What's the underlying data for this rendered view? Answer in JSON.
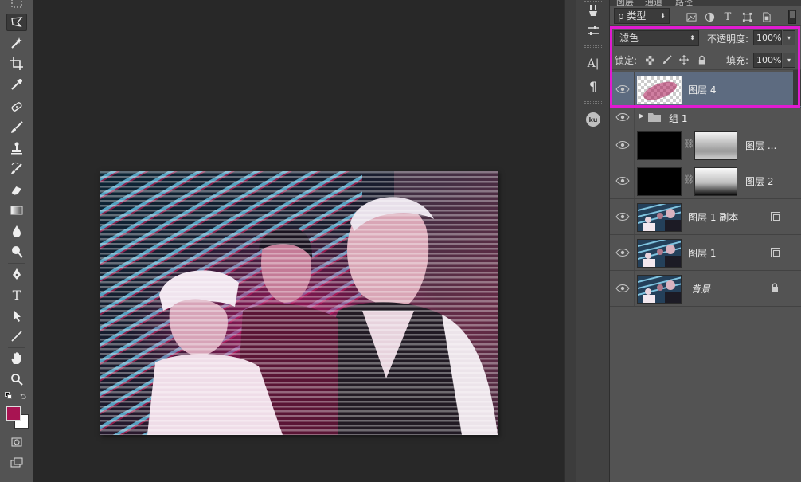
{
  "colors": {
    "foreground": "#a81452",
    "background": "#ffffff",
    "highlight": "#e11bd2",
    "selected_layer": "#5d6b80"
  },
  "toolbar": {
    "tools": [
      "marquee-icon",
      "polygonal-lasso-icon",
      "magic-wand-icon",
      "crop-icon",
      "eyedropper-icon",
      "spot-healing-icon",
      "brush-icon",
      "clone-stamp-icon",
      "history-brush-icon",
      "eraser-icon",
      "gradient-icon",
      "blur-icon",
      "dodge-icon",
      "pen-icon",
      "type-icon",
      "path-selection-icon",
      "line-icon",
      "hand-icon",
      "zoom-icon"
    ],
    "type_tool_glyph": "T"
  },
  "dock": {
    "character_glyph": "A|",
    "paragraph_glyph": "¶",
    "ku_label": "ku"
  },
  "layers_panel": {
    "tabs": [
      "图层",
      "通道",
      "路径"
    ],
    "filter": {
      "kind_label": "ρ 类型",
      "type_glyph": "T"
    },
    "blend_mode": "滤色",
    "opacity_label": "不透明度:",
    "opacity_value": "100%",
    "lock_label": "锁定:",
    "fill_label": "填充:",
    "fill_value": "100%",
    "layers": [
      {
        "name": "图层 4",
        "kind": "pixel",
        "selected": true
      },
      {
        "name": "组 1",
        "kind": "group",
        "selected": false
      },
      {
        "name": "图层 ...",
        "kind": "masked",
        "selected": false
      },
      {
        "name": "图层 2",
        "kind": "masked",
        "selected": false
      },
      {
        "name": "图层 1 副本",
        "kind": "smart",
        "selected": false
      },
      {
        "name": "图层 1",
        "kind": "smart",
        "selected": false
      },
      {
        "name": "背景",
        "kind": "background",
        "selected": false
      }
    ]
  }
}
